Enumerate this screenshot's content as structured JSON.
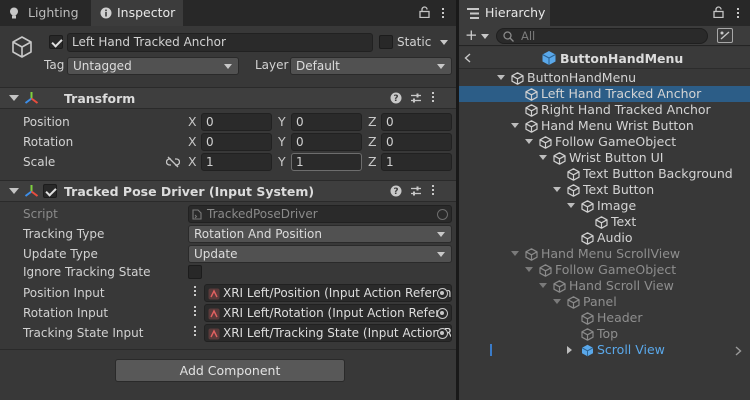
{
  "tabs": {
    "lighting": "Lighting",
    "inspector": "Inspector",
    "hierarchy": "Hierarchy"
  },
  "inspector": {
    "object_name": "Left Hand Tracked Anchor",
    "static_label": "Static",
    "tag_label": "Tag",
    "tag_value": "Untagged",
    "layer_label": "Layer",
    "layer_value": "Default",
    "transform": {
      "title": "Transform",
      "position_label": "Position",
      "rotation_label": "Rotation",
      "scale_label": "Scale",
      "axes": [
        "X",
        "Y",
        "Z"
      ],
      "position": [
        "0",
        "0",
        "0"
      ],
      "rotation": [
        "0",
        "0",
        "0"
      ],
      "scale": [
        "1",
        "1",
        "1"
      ]
    },
    "pose_driver": {
      "title": "Tracked Pose Driver (Input System)",
      "script_label": "Script",
      "script_value": "TrackedPoseDriver",
      "tracking_type_label": "Tracking Type",
      "tracking_type_value": "Rotation And Position",
      "update_type_label": "Update Type",
      "update_type_value": "Update",
      "ignore_state_label": "Ignore Tracking State",
      "position_input_label": "Position Input",
      "position_input_value": "XRI Left/Position (Input Action Referen",
      "rotation_input_label": "Rotation Input",
      "rotation_input_value": "XRI Left/Rotation (Input Action Refere",
      "tracking_state_input_label": "Tracking State Input",
      "tracking_state_input_value": "XRI Left/Tracking State (Input Action R"
    },
    "add_component": "Add Component"
  },
  "hierarchy": {
    "search_placeholder": "All",
    "scene_title": "ButtonHandMenu",
    "items": [
      {
        "label": "ButtonHandMenu",
        "depth": 0,
        "expander": "down",
        "state": "normal"
      },
      {
        "label": "Left Hand Tracked Anchor",
        "depth": 1,
        "expander": "none",
        "state": "selected"
      },
      {
        "label": "Right Hand Tracked Anchor",
        "depth": 1,
        "expander": "none",
        "state": "normal"
      },
      {
        "label": "Hand Menu Wrist Button",
        "depth": 1,
        "expander": "down",
        "state": "normal"
      },
      {
        "label": "Follow GameObject",
        "depth": 2,
        "expander": "down",
        "state": "normal"
      },
      {
        "label": "Wrist Button UI",
        "depth": 3,
        "expander": "down",
        "state": "normal"
      },
      {
        "label": "Text Button Background",
        "depth": 4,
        "expander": "none",
        "state": "normal"
      },
      {
        "label": "Text Button",
        "depth": 4,
        "expander": "down",
        "state": "normal"
      },
      {
        "label": "Image",
        "depth": 5,
        "expander": "down",
        "state": "normal"
      },
      {
        "label": "Text",
        "depth": 6,
        "expander": "none",
        "state": "normal"
      },
      {
        "label": "Audio",
        "depth": 5,
        "expander": "none",
        "state": "normal"
      },
      {
        "label": "Hand Menu ScrollView",
        "depth": 1,
        "expander": "down",
        "state": "inactive"
      },
      {
        "label": "Follow GameObject",
        "depth": 2,
        "expander": "down",
        "state": "inactive"
      },
      {
        "label": "Hand Scroll View",
        "depth": 3,
        "expander": "down",
        "state": "inactive"
      },
      {
        "label": "Panel",
        "depth": 4,
        "expander": "down",
        "state": "inactive"
      },
      {
        "label": "Header",
        "depth": 5,
        "expander": "none",
        "state": "inactive"
      },
      {
        "label": "Top",
        "depth": 5,
        "expander": "none",
        "state": "inactive"
      },
      {
        "label": "Scroll View",
        "depth": 5,
        "expander": "right",
        "state": "prefab"
      }
    ]
  }
}
